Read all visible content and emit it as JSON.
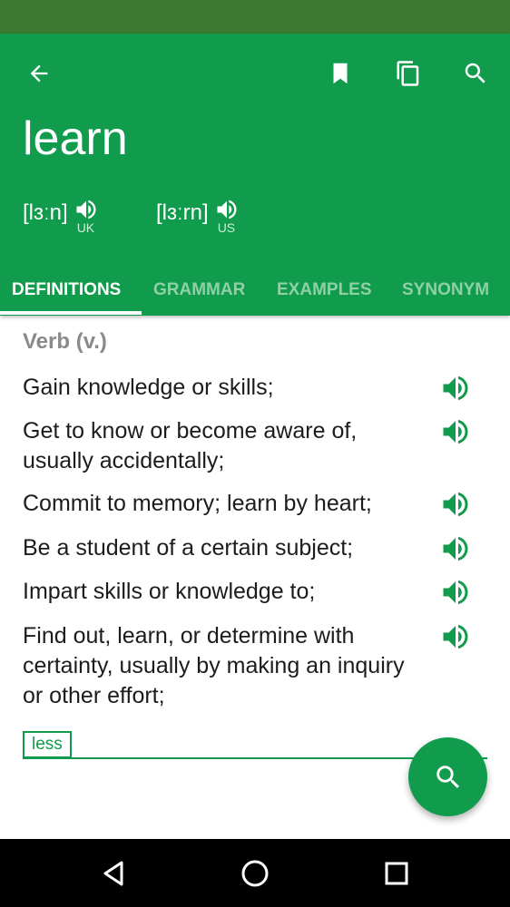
{
  "header": {
    "back_icon": "arrow-left-icon",
    "bookmark_icon": "bookmark-icon",
    "copy_icon": "copy-icon",
    "search_icon": "search-icon",
    "word": "learn",
    "pronunciations": [
      {
        "ipa": "[lɜːn]",
        "region": "UK"
      },
      {
        "ipa": "[lɜːrn]",
        "region": "US"
      }
    ]
  },
  "tabs": [
    {
      "label": "DEFINITIONS",
      "active": true
    },
    {
      "label": "GRAMMAR",
      "active": false
    },
    {
      "label": "EXAMPLES",
      "active": false
    },
    {
      "label": "SYNONYM",
      "active": false
    }
  ],
  "definitions": {
    "part_of_speech": "Verb (v.)",
    "items": [
      "Gain knowledge or skills;",
      "Get to know or become aware of, usually accidentally;",
      "Commit to memory; learn by heart;",
      "Be a student of a certain subject;",
      "Impart skills or knowledge to;",
      "Find out, learn, or determine with certainty, usually by making an inquiry or other effort;"
    ],
    "less_label": "less"
  },
  "fab_icon": "search-icon",
  "navbar": {
    "back": "triangle-back-icon",
    "home": "circle-home-icon",
    "recents": "square-recents-icon"
  },
  "colors": {
    "primary": "#109c4c",
    "status_bar": "#3b7a2f",
    "inactive_tab": "#8fd0a6"
  }
}
